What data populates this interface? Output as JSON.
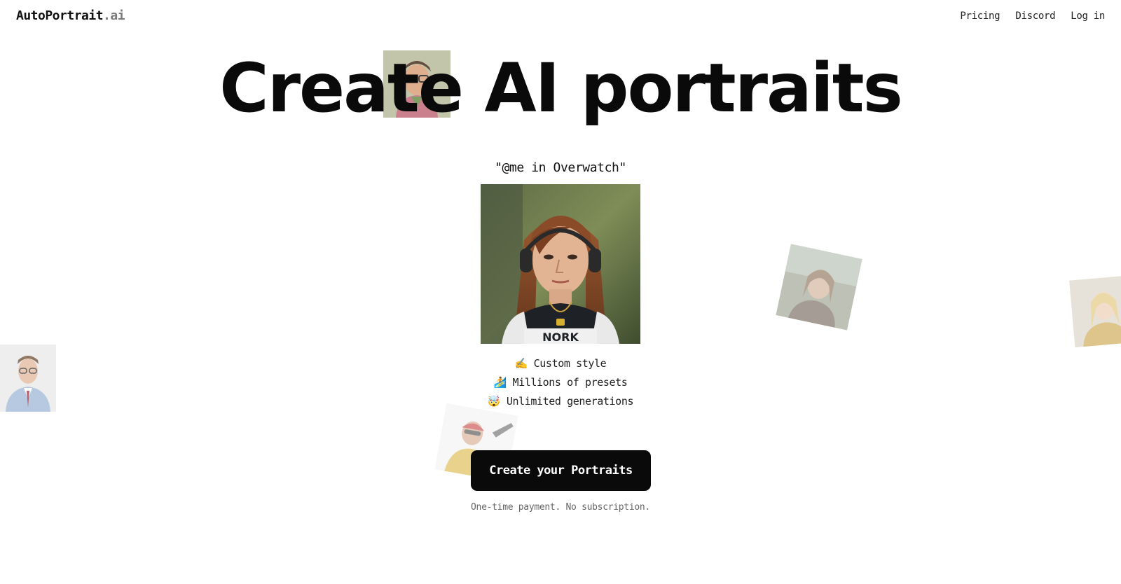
{
  "header": {
    "logo_main": "AutoPortrait",
    "logo_suffix": ".ai",
    "nav": [
      {
        "label": "Pricing"
      },
      {
        "label": "Discord"
      },
      {
        "label": "Log in"
      }
    ]
  },
  "hero": {
    "headline": "Create AI portraits",
    "prompt": "\"@me in Overwatch\"",
    "main_image_alt": "AI portrait of a woman with headphones in Overwatch style",
    "features": [
      {
        "emoji": "✍️",
        "text": "Custom style"
      },
      {
        "emoji": "🏄",
        "text": "Millions of presets"
      },
      {
        "emoji": "🤯",
        "text": "Unlimited generations"
      }
    ],
    "cta_label": "Create your Portraits",
    "cta_note": "One-time payment. No subscription."
  }
}
